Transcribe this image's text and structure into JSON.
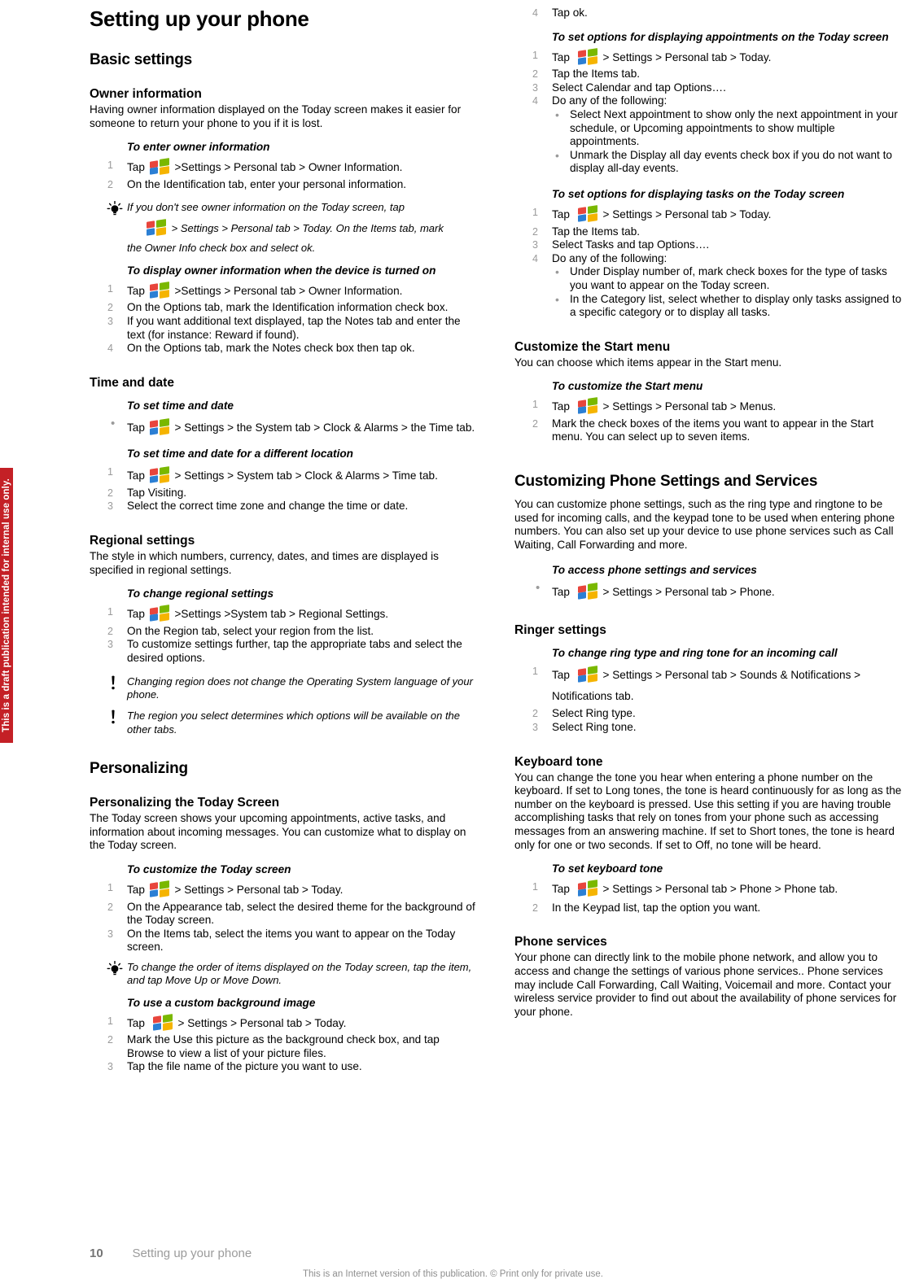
{
  "draft_banner": "This is a draft publication intended for internal use only.",
  "footer": {
    "page_number": "10",
    "chapter_label": "Setting up your phone",
    "internet_note": "This is an Internet version of this publication. © Print only for private use."
  },
  "icons": {
    "windows": "windows-logo-icon",
    "tip": "lightbulb-tip-icon",
    "note": "exclamation-note-icon"
  },
  "left_column": {
    "chapter_title": "Setting up your phone",
    "section_title": "Basic settings",
    "owner_information": {
      "heading": "Owner information",
      "intro": "Having owner information displayed on the Today screen makes it easier for someone to return your phone to you if it is lost.",
      "proc1_title": "To enter owner information",
      "proc1_steps": [
        {
          "num": "1",
          "pre": "Tap",
          "post": ">Settings > Personal tab > Owner Information."
        },
        {
          "num": "2",
          "text": "On the Identification tab, enter your personal information."
        }
      ],
      "tip1_a": "If you don't see owner information on the Today screen, tap",
      "tip1_b": "> Settings > Personal tab > Today. On the Items tab, mark",
      "tip1_c": "the Owner Info check box and select ok.",
      "proc2_title": "To display owner information when the device is turned on",
      "proc2_steps": [
        {
          "num": "1",
          "pre": "Tap",
          "post": ">Settings > Personal tab > Owner Information."
        },
        {
          "num": "2",
          "text": "On the Options tab, mark the Identification information check box."
        },
        {
          "num": "3",
          "text": "If you want additional text displayed, tap the Notes tab and enter the text (for instance: Reward if found)."
        },
        {
          "num": "4",
          "text": "On the Options tab, mark the Notes check box then tap ok."
        }
      ]
    },
    "time_and_date": {
      "heading": "Time and date",
      "proc1_title": "To set time and date",
      "proc1_pre": "Tap",
      "proc1_post": "> Settings > the System tab > Clock & Alarms > the Time tab.",
      "proc2_title": "To set time and date for a different location",
      "proc2_steps": [
        {
          "num": "1",
          "pre": "Tap",
          "post": "> Settings > System tab > Clock & Alarms > Time tab."
        },
        {
          "num": "2",
          "text": "Tap Visiting."
        },
        {
          "num": "3",
          "text": "Select the correct time zone and change the time or date."
        }
      ]
    },
    "regional_settings": {
      "heading": "Regional settings",
      "intro": "The style in which numbers, currency, dates, and times are displayed is specified in regional settings.",
      "proc_title": "To change regional settings",
      "steps": [
        {
          "num": "1",
          "pre": "Tap",
          "post": ">Settings >System tab > Regional Settings."
        },
        {
          "num": "2",
          "text": "On the Region tab, select your region from the list."
        },
        {
          "num": "3",
          "text": "To customize settings further, tap the appropriate tabs and select the desired options."
        }
      ],
      "note1": "Changing region does not change the Operating System language of your phone.",
      "note2": "The region you select determines which options will be available on the other tabs."
    },
    "personalizing": {
      "section_title": "Personalizing",
      "today_screen": {
        "heading": "Personalizing the Today Screen",
        "intro": "The Today screen shows your upcoming appointments, active tasks, and information about incoming messages. You can customize what to display on the Today screen.",
        "proc1_title": "To customize the Today screen",
        "proc1_steps": [
          {
            "num": "1",
            "pre": "Tap",
            "post": "> Settings > Personal tab > Today."
          },
          {
            "num": "2",
            "text": "On the Appearance tab, select the desired theme for the background of the Today screen."
          },
          {
            "num": "3",
            "text": "On the Items tab, select the items you want to appear on the Today screen."
          }
        ],
        "tip": "To change the order of items displayed on the Today screen, tap the item, and tap Move Up or Move Down.",
        "proc2_title": "To use a custom background image",
        "proc2_steps": [
          {
            "num": "1",
            "pre": "Tap",
            "post": "> Settings > Personal tab > Today."
          },
          {
            "num": "2",
            "text": "Mark the Use this picture as the background check box, and tap Browse to view a list of your picture files."
          },
          {
            "num": "3",
            "text": "Tap the file name of the picture you want to use."
          }
        ]
      }
    }
  },
  "right_column": {
    "cont_step4": {
      "num": "4",
      "text": "Tap ok."
    },
    "appointments": {
      "proc_title": "To set options for displaying appointments on the Today screen",
      "steps": [
        {
          "num": "1",
          "pre": "Tap",
          "post": "> Settings > Personal tab > Today."
        },
        {
          "num": "2",
          "text": "Tap the Items tab."
        },
        {
          "num": "3",
          "text": "Select Calendar and tap Options…."
        },
        {
          "num": "4",
          "text": "Do any of the following:"
        }
      ],
      "subbullets": [
        "Select Next appointment to show only the next appointment in your schedule, or Upcoming appointments to show multiple appointments.",
        "Unmark the Display all day events check box if you do not want to display all-day events."
      ]
    },
    "tasks": {
      "proc_title": "To set options for displaying tasks on the Today screen",
      "steps": [
        {
          "num": "1",
          "pre": "Tap",
          "post": "> Settings > Personal tab > Today."
        },
        {
          "num": "2",
          "text": "Tap the Items tab."
        },
        {
          "num": "3",
          "text": "Select Tasks and tap Options…."
        },
        {
          "num": "4",
          "text": "Do any of the following:"
        }
      ],
      "subbullets": [
        "Under Display number of, mark check boxes for the type of tasks you want to appear on the Today screen.",
        "In the Category list, select whether to display only tasks assigned to a specific category or to display all tasks."
      ]
    },
    "start_menu": {
      "heading": "Customize the Start menu",
      "intro": "You can choose which items appear in the Start menu.",
      "proc_title": "To customize the Start menu",
      "steps": [
        {
          "num": "1",
          "pre": "Tap",
          "post": "> Settings > Personal tab > Menus."
        },
        {
          "num": "2",
          "text": "Mark the check boxes of the items you want to appear in the Start menu. You can select up to seven items."
        }
      ]
    },
    "phone_settings": {
      "section_title": "Customizing Phone Settings and Services",
      "intro": "You can customize phone settings, such as the ring type and ringtone to be used for incoming calls, and the keypad tone to be used when entering phone numbers. You can also set up your device to use phone services such as Call Waiting, Call Forwarding and more.",
      "proc_title": "To access phone settings and services",
      "proc_pre": "Tap",
      "proc_post": "> Settings > Personal tab > Phone."
    },
    "ringer_settings": {
      "heading": "Ringer settings",
      "proc_title": "To change ring type and ring tone for an incoming call",
      "steps": [
        {
          "num": "1",
          "pre": "Tap",
          "post": "> Settings > Personal tab > Sounds & Notifications > Notifications tab."
        },
        {
          "num": "2",
          "text": "Select Ring type."
        },
        {
          "num": "3",
          "text": "Select Ring tone."
        }
      ]
    },
    "keyboard_tone": {
      "heading": "Keyboard tone",
      "intro": "You can change the tone you hear when entering a phone number on the keyboard. If set to Long tones, the tone is heard continuously for as long as the number on the keyboard is pressed. Use this setting if you are having trouble accomplishing tasks that rely on tones from your phone such as accessing messages from an answering machine. If set to Short tones, the tone is heard only for one or two seconds. If set to Off, no tone will be heard.",
      "proc_title": "To set keyboard tone",
      "steps": [
        {
          "num": "1",
          "pre": "Tap",
          "post": "> Settings > Personal tab > Phone > Phone tab."
        },
        {
          "num": "2",
          "text": "In the Keypad list, tap the option you want."
        }
      ]
    },
    "phone_services": {
      "heading": "Phone services",
      "intro": "Your phone can directly link to the mobile phone network, and allow you to access and change the settings of various phone services.. Phone services may include Call Forwarding, Call Waiting, Voicemail and more. Contact your wireless service provider to find out about the availability of phone services for your phone."
    }
  }
}
